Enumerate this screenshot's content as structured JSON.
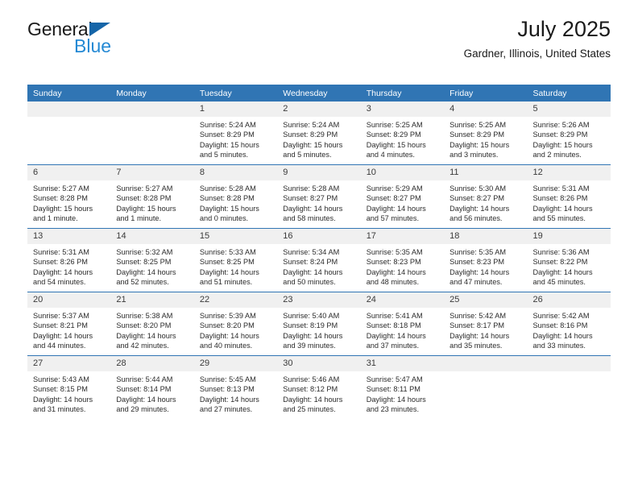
{
  "brand": {
    "name_top": "General",
    "name_bottom": "Blue",
    "triangle_color": "#1565a8",
    "blue_color": "#2489d4"
  },
  "header": {
    "title": "July 2025",
    "subtitle": "Gardner, Illinois, United States"
  },
  "theme": {
    "header_bg": "#3075b4",
    "daynum_bg": "#f0f0f0",
    "row_divider": "#3075b4",
    "text": "#2b2b2b"
  },
  "weekday_headers": [
    "Sunday",
    "Monday",
    "Tuesday",
    "Wednesday",
    "Thursday",
    "Friday",
    "Saturday"
  ],
  "labels": {
    "sunrise_prefix": "Sunrise:",
    "sunset_prefix": "Sunset:",
    "daylight_prefix": "Daylight:"
  },
  "weeks": [
    [
      {
        "day": "",
        "sunrise": "",
        "sunset": "",
        "daylight": "",
        "empty": true
      },
      {
        "day": "",
        "sunrise": "",
        "sunset": "",
        "daylight": "",
        "empty": true
      },
      {
        "day": "1",
        "sunrise": "Sunrise: 5:24 AM",
        "sunset": "Sunset: 8:29 PM",
        "daylight": "Daylight: 15 hours and 5 minutes."
      },
      {
        "day": "2",
        "sunrise": "Sunrise: 5:24 AM",
        "sunset": "Sunset: 8:29 PM",
        "daylight": "Daylight: 15 hours and 5 minutes."
      },
      {
        "day": "3",
        "sunrise": "Sunrise: 5:25 AM",
        "sunset": "Sunset: 8:29 PM",
        "daylight": "Daylight: 15 hours and 4 minutes."
      },
      {
        "day": "4",
        "sunrise": "Sunrise: 5:25 AM",
        "sunset": "Sunset: 8:29 PM",
        "daylight": "Daylight: 15 hours and 3 minutes."
      },
      {
        "day": "5",
        "sunrise": "Sunrise: 5:26 AM",
        "sunset": "Sunset: 8:29 PM",
        "daylight": "Daylight: 15 hours and 2 minutes."
      }
    ],
    [
      {
        "day": "6",
        "sunrise": "Sunrise: 5:27 AM",
        "sunset": "Sunset: 8:28 PM",
        "daylight": "Daylight: 15 hours and 1 minute."
      },
      {
        "day": "7",
        "sunrise": "Sunrise: 5:27 AM",
        "sunset": "Sunset: 8:28 PM",
        "daylight": "Daylight: 15 hours and 1 minute."
      },
      {
        "day": "8",
        "sunrise": "Sunrise: 5:28 AM",
        "sunset": "Sunset: 8:28 PM",
        "daylight": "Daylight: 15 hours and 0 minutes."
      },
      {
        "day": "9",
        "sunrise": "Sunrise: 5:28 AM",
        "sunset": "Sunset: 8:27 PM",
        "daylight": "Daylight: 14 hours and 58 minutes."
      },
      {
        "day": "10",
        "sunrise": "Sunrise: 5:29 AM",
        "sunset": "Sunset: 8:27 PM",
        "daylight": "Daylight: 14 hours and 57 minutes."
      },
      {
        "day": "11",
        "sunrise": "Sunrise: 5:30 AM",
        "sunset": "Sunset: 8:27 PM",
        "daylight": "Daylight: 14 hours and 56 minutes."
      },
      {
        "day": "12",
        "sunrise": "Sunrise: 5:31 AM",
        "sunset": "Sunset: 8:26 PM",
        "daylight": "Daylight: 14 hours and 55 minutes."
      }
    ],
    [
      {
        "day": "13",
        "sunrise": "Sunrise: 5:31 AM",
        "sunset": "Sunset: 8:26 PM",
        "daylight": "Daylight: 14 hours and 54 minutes."
      },
      {
        "day": "14",
        "sunrise": "Sunrise: 5:32 AM",
        "sunset": "Sunset: 8:25 PM",
        "daylight": "Daylight: 14 hours and 52 minutes."
      },
      {
        "day": "15",
        "sunrise": "Sunrise: 5:33 AM",
        "sunset": "Sunset: 8:25 PM",
        "daylight": "Daylight: 14 hours and 51 minutes."
      },
      {
        "day": "16",
        "sunrise": "Sunrise: 5:34 AM",
        "sunset": "Sunset: 8:24 PM",
        "daylight": "Daylight: 14 hours and 50 minutes."
      },
      {
        "day": "17",
        "sunrise": "Sunrise: 5:35 AM",
        "sunset": "Sunset: 8:23 PM",
        "daylight": "Daylight: 14 hours and 48 minutes."
      },
      {
        "day": "18",
        "sunrise": "Sunrise: 5:35 AM",
        "sunset": "Sunset: 8:23 PM",
        "daylight": "Daylight: 14 hours and 47 minutes."
      },
      {
        "day": "19",
        "sunrise": "Sunrise: 5:36 AM",
        "sunset": "Sunset: 8:22 PM",
        "daylight": "Daylight: 14 hours and 45 minutes."
      }
    ],
    [
      {
        "day": "20",
        "sunrise": "Sunrise: 5:37 AM",
        "sunset": "Sunset: 8:21 PM",
        "daylight": "Daylight: 14 hours and 44 minutes."
      },
      {
        "day": "21",
        "sunrise": "Sunrise: 5:38 AM",
        "sunset": "Sunset: 8:20 PM",
        "daylight": "Daylight: 14 hours and 42 minutes."
      },
      {
        "day": "22",
        "sunrise": "Sunrise: 5:39 AM",
        "sunset": "Sunset: 8:20 PM",
        "daylight": "Daylight: 14 hours and 40 minutes."
      },
      {
        "day": "23",
        "sunrise": "Sunrise: 5:40 AM",
        "sunset": "Sunset: 8:19 PM",
        "daylight": "Daylight: 14 hours and 39 minutes."
      },
      {
        "day": "24",
        "sunrise": "Sunrise: 5:41 AM",
        "sunset": "Sunset: 8:18 PM",
        "daylight": "Daylight: 14 hours and 37 minutes."
      },
      {
        "day": "25",
        "sunrise": "Sunrise: 5:42 AM",
        "sunset": "Sunset: 8:17 PM",
        "daylight": "Daylight: 14 hours and 35 minutes."
      },
      {
        "day": "26",
        "sunrise": "Sunrise: 5:42 AM",
        "sunset": "Sunset: 8:16 PM",
        "daylight": "Daylight: 14 hours and 33 minutes."
      }
    ],
    [
      {
        "day": "27",
        "sunrise": "Sunrise: 5:43 AM",
        "sunset": "Sunset: 8:15 PM",
        "daylight": "Daylight: 14 hours and 31 minutes."
      },
      {
        "day": "28",
        "sunrise": "Sunrise: 5:44 AM",
        "sunset": "Sunset: 8:14 PM",
        "daylight": "Daylight: 14 hours and 29 minutes."
      },
      {
        "day": "29",
        "sunrise": "Sunrise: 5:45 AM",
        "sunset": "Sunset: 8:13 PM",
        "daylight": "Daylight: 14 hours and 27 minutes."
      },
      {
        "day": "30",
        "sunrise": "Sunrise: 5:46 AM",
        "sunset": "Sunset: 8:12 PM",
        "daylight": "Daylight: 14 hours and 25 minutes."
      },
      {
        "day": "31",
        "sunrise": "Sunrise: 5:47 AM",
        "sunset": "Sunset: 8:11 PM",
        "daylight": "Daylight: 14 hours and 23 minutes."
      },
      {
        "day": "",
        "sunrise": "",
        "sunset": "",
        "daylight": "",
        "empty": true
      },
      {
        "day": "",
        "sunrise": "",
        "sunset": "",
        "daylight": "",
        "empty": true
      }
    ]
  ]
}
